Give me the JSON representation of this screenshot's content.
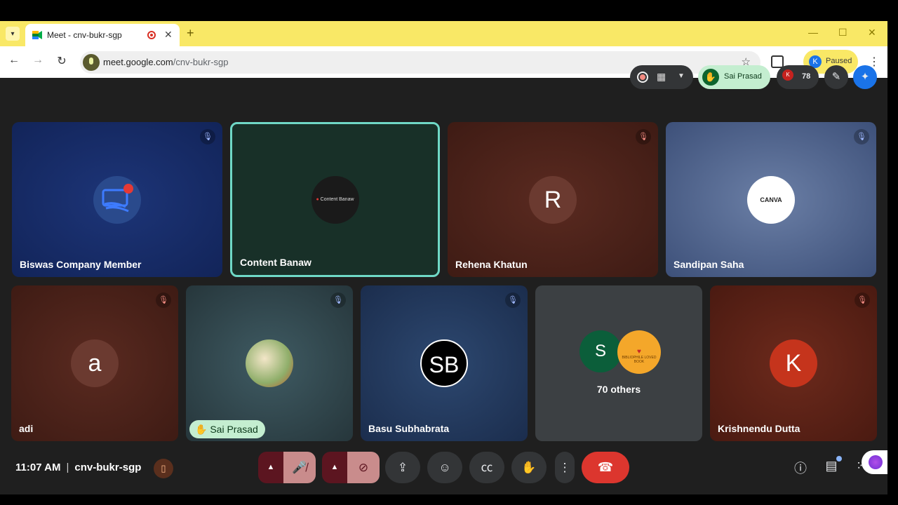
{
  "browser": {
    "tab_title": "Meet - cnv-bukr-sgp",
    "url_host": "meet.google.com",
    "url_path": "/cnv-bukr-sgp",
    "profile_initial": "K",
    "profile_status": "Paused"
  },
  "top_controls": {
    "hand_raised_by": "Sai Prasad",
    "participant_count": "78",
    "people_initial": "K"
  },
  "tiles": [
    {
      "name": "Biswas Company Member",
      "mic": "muted"
    },
    {
      "name": "Content Banaw",
      "avatar_text": "Content Banaw",
      "active_speaker": true
    },
    {
      "name": "Rehena Khatun",
      "avatar_letter": "R",
      "mic": "muted"
    },
    {
      "name": "Sandipan Saha",
      "avatar_text": "CANVA",
      "mic": "muted"
    },
    {
      "name": "adi",
      "avatar_letter": "a",
      "mic": "muted"
    },
    {
      "name": "Sai Prasad",
      "mic": "muted",
      "hand_raised": true
    },
    {
      "name": "Basu Subhabrata",
      "avatar_letter": "SB",
      "mic": "muted"
    },
    {
      "name": "70 others",
      "avatar_letter": "S",
      "avatar_text_2": "BIBLIOPHILE LOVED BOOK"
    },
    {
      "name": "Krishnendu Dutta",
      "avatar_letter": "K",
      "mic": "muted"
    }
  ],
  "bottom_bar": {
    "time": "11:07 AM",
    "meeting_code": "cnv-bukr-sgp"
  },
  "colors": {
    "accent_speaker_border": "#6fd8c6",
    "leave_red": "#dc362e",
    "hand_green": "#c4eed0"
  },
  "icons": [
    "mic-off-icon",
    "camera-off-icon",
    "present-icon",
    "emoji-icon",
    "captions-icon",
    "raise-hand-icon",
    "more-icon",
    "leave-call-icon",
    "info-icon",
    "chat-icon",
    "activities-icon"
  ]
}
